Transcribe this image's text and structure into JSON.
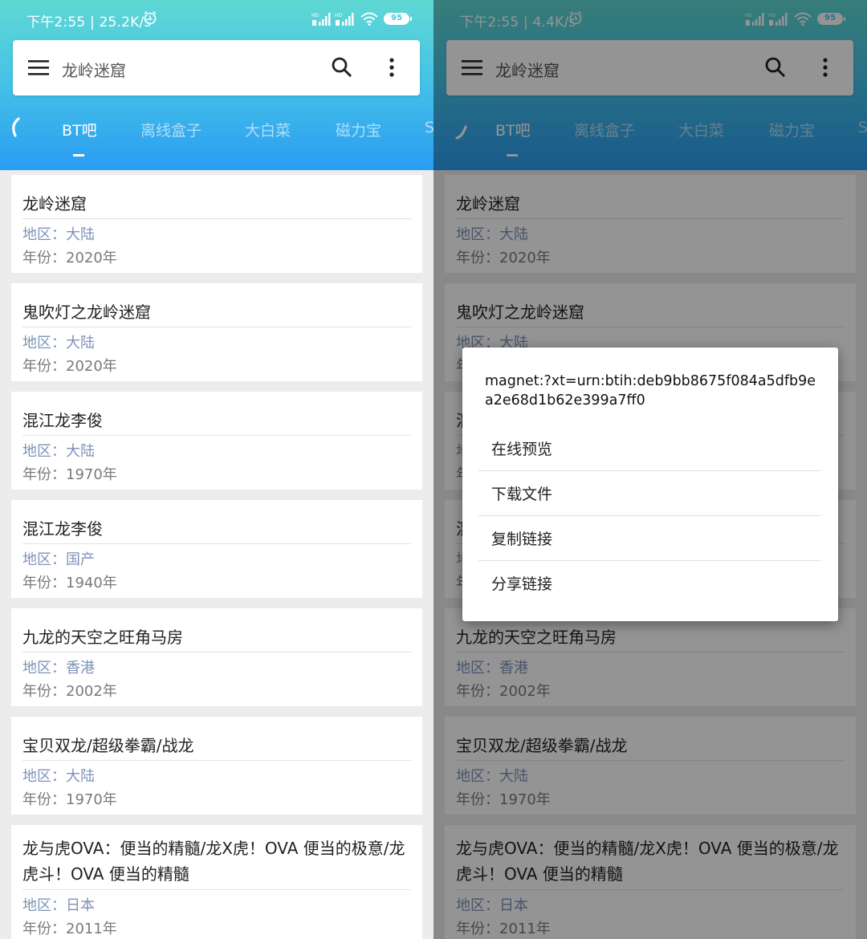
{
  "status_left": "下午2:55 | 25.2K/s",
  "status_right": "下午2:55 | 4.4K/s",
  "signal_label": "HD",
  "battery": "95",
  "search": {
    "query": "龙岭迷窟"
  },
  "tabs": [
    "BT吧",
    "离线盒子",
    "大白菜",
    "磁力宝",
    "S"
  ],
  "results": [
    {
      "title": "龙岭迷窟",
      "region": "地区：大陆",
      "year": "年份：2020年"
    },
    {
      "title": "鬼吹灯之龙岭迷窟",
      "region": "地区：大陆",
      "year": "年份：2020年"
    },
    {
      "title": "混江龙李俊",
      "region": "地区：大陆",
      "year": "年份：1970年"
    },
    {
      "title": "混江龙李俊",
      "region": "地区：国产",
      "year": "年份：1940年"
    },
    {
      "title": "九龙的天空之旺角马房",
      "region": "地区：香港",
      "year": "年份：2002年"
    },
    {
      "title": "宝贝双龙/超级拳霸/战龙",
      "region": "地区：大陆",
      "year": "年份：1970年"
    },
    {
      "title": "龙与虎OVA：便当的精髓/龙X虎！OVA 便当的极意/龙虎斗！OVA 便当的精髓",
      "region": "地区：日本",
      "year": "年份：2011年"
    }
  ],
  "dialog": {
    "title": "magnet:?xt=urn:btih:deb9bb8675f084a5dfb9ea2e68d1b62e399a7ff0",
    "items": [
      "在线预览",
      "下载文件",
      "复制链接",
      "分享链接"
    ]
  },
  "colors": {
    "header_gradient_top": "#5fd8d3",
    "header_gradient_bottom": "#2a9cf2",
    "region_text": "#7c92b8",
    "year_text": "#7a7a7a"
  }
}
